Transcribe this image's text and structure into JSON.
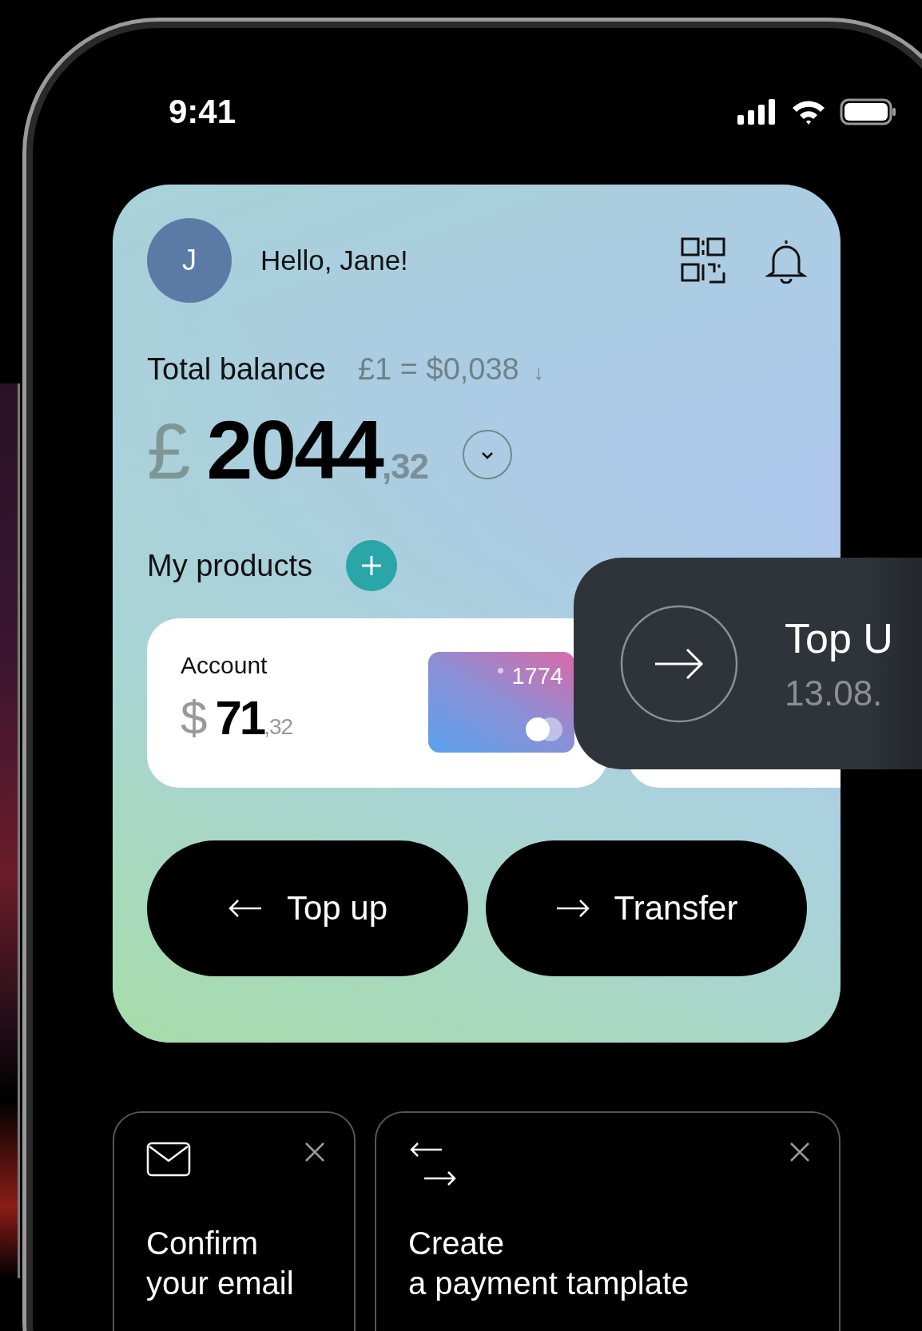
{
  "status_bar": {
    "time": "9:41"
  },
  "header": {
    "avatar_initial": "J",
    "greeting": "Hello, Jane!"
  },
  "balance": {
    "label": "Total balance",
    "rate": "£1 = $0,038",
    "rate_arrow": "↓",
    "currency": "£",
    "whole": "2044",
    "fraction": ",32"
  },
  "products": {
    "title": "My products",
    "items": [
      {
        "kind": "account",
        "name": "Account",
        "currency": "$",
        "whole": "71",
        "fraction": ",32",
        "card_number": "1774"
      },
      {
        "kind": "covered"
      }
    ]
  },
  "actions": [
    {
      "kind": "in",
      "label": "Top up"
    },
    {
      "kind": "out",
      "label": "Transfer"
    }
  ],
  "toast": {
    "title": "Top U",
    "date": "13.08."
  },
  "tips": [
    {
      "kind": "email",
      "text": "Confirm\nyour email"
    },
    {
      "kind": "template",
      "text": "Create\na payment tamplate"
    }
  ]
}
